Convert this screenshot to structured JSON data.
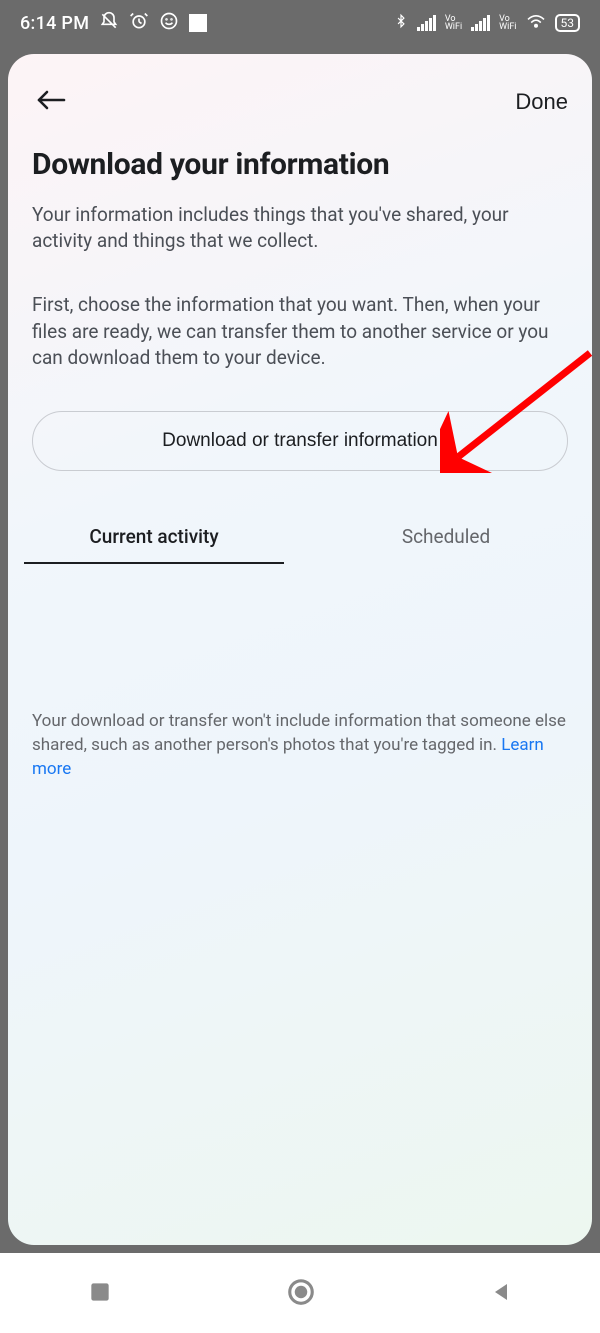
{
  "status": {
    "time": "6:14 PM",
    "battery": "53"
  },
  "header": {
    "done": "Done"
  },
  "title": "Download your information",
  "paragraph1": "Your information includes things that you've shared, your activity and things that we collect.",
  "paragraph2": "First, choose the information that you want. Then, when your files are ready, we can transfer them to another service or you can download them to your device.",
  "cta_label": "Download or transfer information",
  "tabs": {
    "current": "Current activity",
    "scheduled": "Scheduled"
  },
  "footnote_text": "Your download or transfer won't include information that someone else shared, such as another person's photos that you're tagged in. ",
  "footnote_link": "Learn more"
}
